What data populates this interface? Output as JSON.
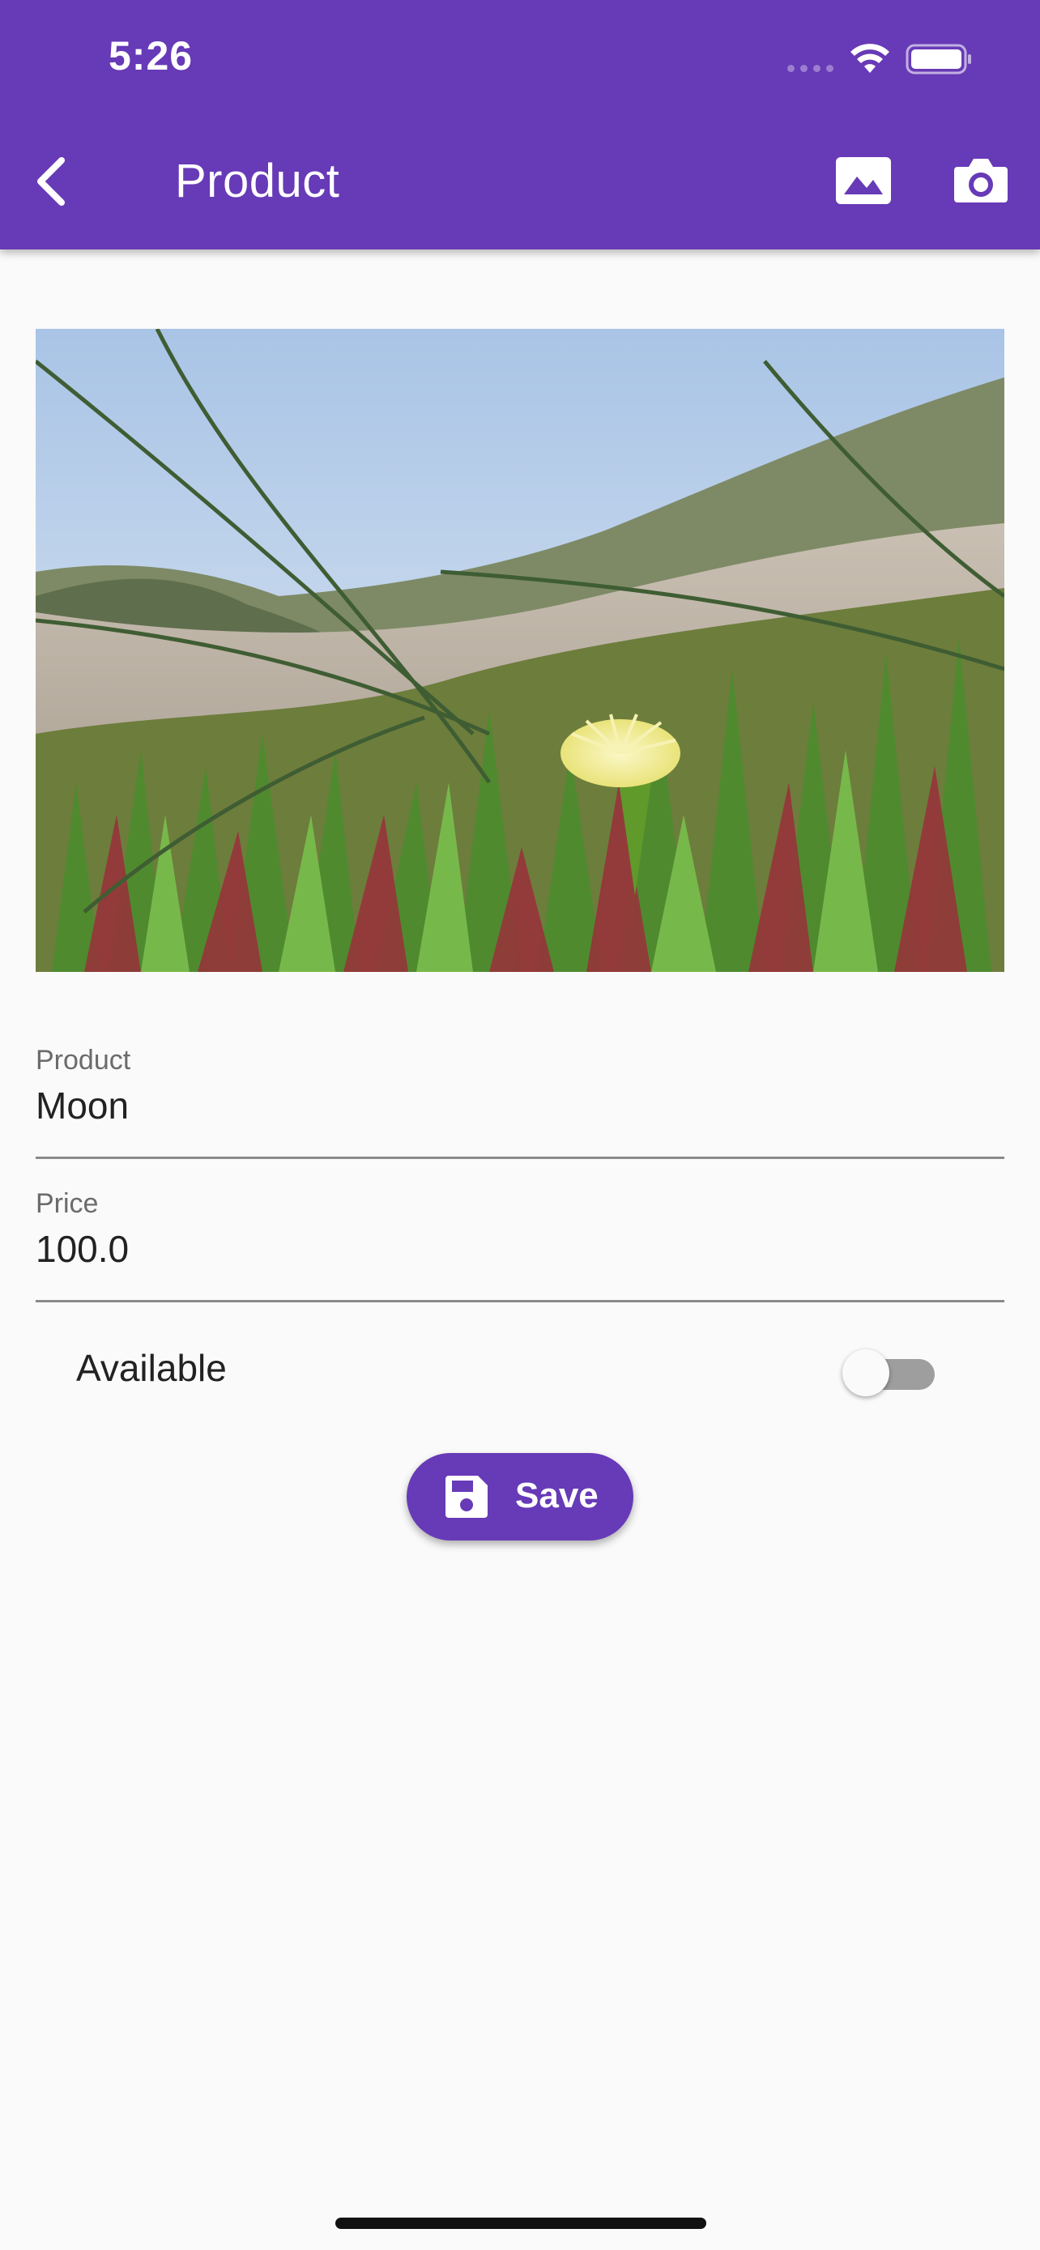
{
  "status_bar": {
    "time": "5:26"
  },
  "app_bar": {
    "title": "Product",
    "background": "#673ab7",
    "icons": [
      "back-arrow-icon",
      "gallery-icon",
      "camera-icon"
    ]
  },
  "image": {
    "subject": "yellow ice plant flower on sand dune",
    "icon": "photo"
  },
  "form": {
    "product": {
      "label": "Product",
      "value": "Moon"
    },
    "price": {
      "label": "Price",
      "value": "100.0"
    },
    "available": {
      "label": "Available",
      "checked": false
    }
  },
  "save_button": {
    "label": "Save",
    "icon": "save-icon",
    "color": "#673ab7"
  }
}
